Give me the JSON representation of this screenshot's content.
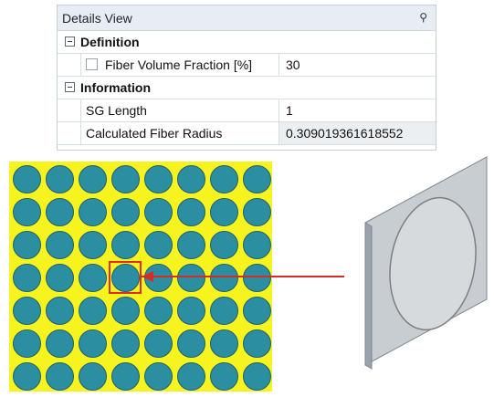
{
  "details_view": {
    "title": "Details View",
    "pin_icon": "pin-icon",
    "groups": [
      {
        "label": "Definition",
        "rows": [
          {
            "name": "Fiber Volume Fraction [%]",
            "value": "30",
            "has_checkbox": true,
            "readonly": false
          }
        ]
      },
      {
        "label": "Information",
        "rows": [
          {
            "name": "SG Length",
            "value": "1",
            "has_checkbox": false,
            "readonly": false
          },
          {
            "name": "Calculated Fiber Radius",
            "value": "0.309019361618552",
            "has_checkbox": false,
            "readonly": true
          }
        ]
      }
    ]
  },
  "fiber_pattern": {
    "rows": 7,
    "columns": 8,
    "matrix_color": "#f7f31f",
    "fiber_color": "#2b8ea1",
    "highlight": {
      "row": 4,
      "column": 4,
      "color": "#e22b24"
    }
  },
  "arrow": {
    "color": "#d52b24"
  },
  "plate": {
    "face_color": "#c8cdd2",
    "edge_color": "#7f8791",
    "fiber_section_color": "#d7dadc"
  }
}
